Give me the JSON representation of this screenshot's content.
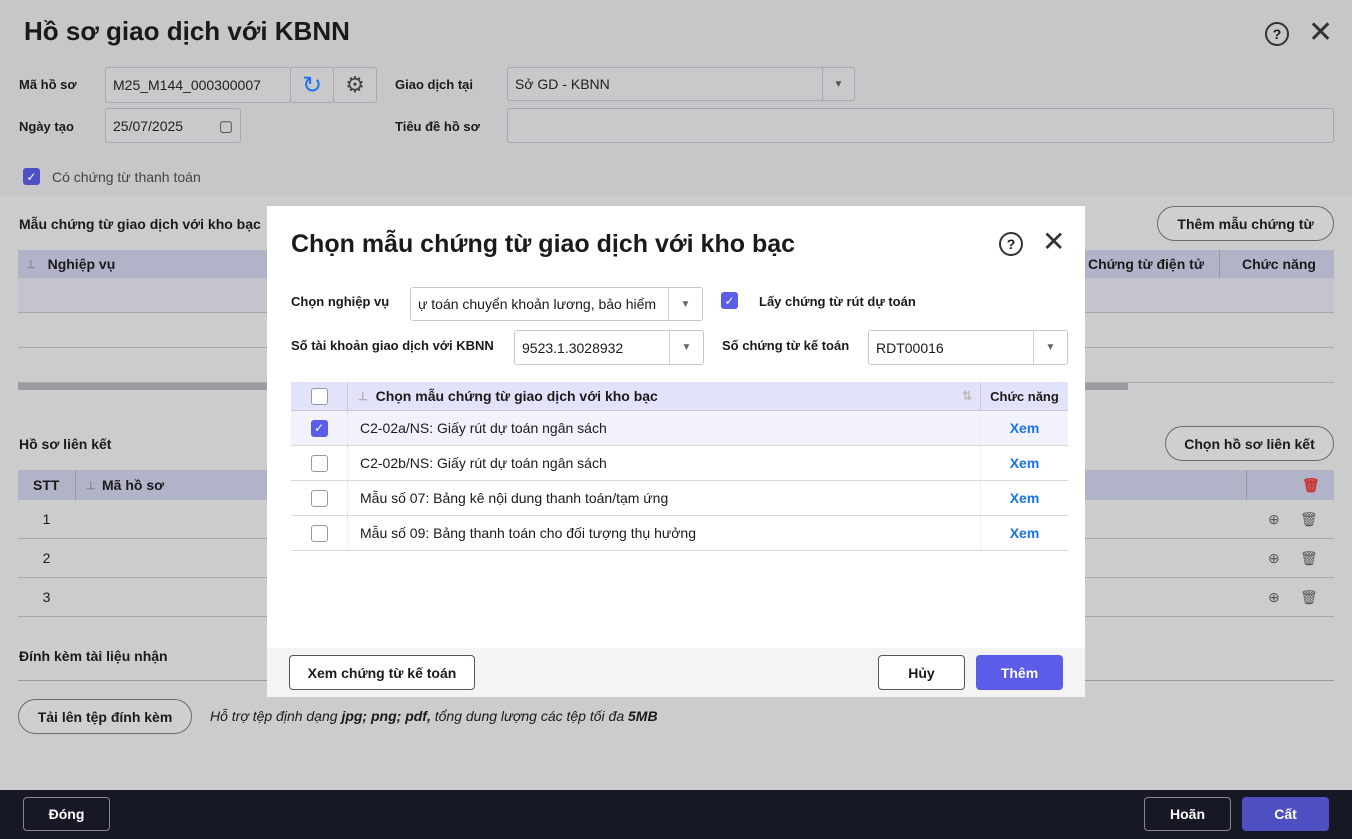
{
  "page": {
    "title": "Hồ sơ giao dịch với KBNN",
    "ma_ho_so_label": "Mã hồ sơ",
    "ma_ho_so_value": "M25_M144_000300007",
    "giao_dich_tai_label": "Giao dịch tại",
    "giao_dich_tai_value": "Sở GD - KBNN",
    "ngay_tao_label": "Ngày tạo",
    "ngay_tao_value": "25/07/2025",
    "tieu_de_label": "Tiêu đề hồ sơ",
    "tieu_de_value": "",
    "co_chung_tu_label": "Có chứng từ thanh toán",
    "co_chung_tu_checked": true
  },
  "mau_section": {
    "title": "Mẫu chứng từ giao dịch với kho bạc",
    "add_button": "Thêm mẫu chứng từ",
    "columns": [
      "Nghiệp vụ",
      "Chứng từ điện tử",
      "Chức năng"
    ]
  },
  "lien_ket": {
    "title": "Hồ sơ liên kết",
    "button": "Chọn hồ sơ liên kết",
    "columns": [
      "STT",
      "Mã hồ sơ"
    ],
    "rows": [
      "1",
      "2",
      "3"
    ]
  },
  "dinh_kem": {
    "title": "Đính kèm tài liệu nhận",
    "upload_button": "Tải lên tệp đính kèm",
    "hint_prefix": "Hỗ trợ tệp định dạng ",
    "hint_formats": "jpg; png; pdf,",
    "hint_mid": " tổng dung lượng các tệp tối đa ",
    "hint_size": "5MB"
  },
  "footer": {
    "close": "Đóng",
    "postpone": "Hoãn",
    "save": "Cất"
  },
  "modal": {
    "title": "Chọn mẫu chứng từ giao dịch với kho bạc",
    "nghiep_vu_label": "Chọn nghiệp vụ",
    "nghiep_vu_value": "ự toán chuyển khoản lương, bảo hiểm",
    "lay_chung_tu_label": "Lấy chứng từ rút dự toán",
    "lay_chung_tu_checked": true,
    "tai_khoan_label": "Số tài khoản giao dịch với KBNN",
    "tai_khoan_value": "9523.1.3028932",
    "so_chung_tu_label": "Số chứng từ kế toán",
    "so_chung_tu_value": "RDT00016",
    "col_name": "Chọn mẫu chứng từ giao dịch với kho bạc",
    "col_action": "Chức năng",
    "rows": [
      {
        "name": "C2-02a/NS: Giấy rút dự toán ngân sách",
        "action": "Xem",
        "checked": true
      },
      {
        "name": "C2-02b/NS: Giấy rút dự toán ngân sách",
        "action": "Xem",
        "checked": false
      },
      {
        "name": "Mẫu số 07: Bảng kê nội dung thanh toán/tạm ứng",
        "action": "Xem",
        "checked": false
      },
      {
        "name": "Mẫu số 09: Bảng thanh toán cho đối tượng thụ hưởng",
        "action": "Xem",
        "checked": false
      }
    ],
    "view_accounting": "Xem chứng từ kế toán",
    "cancel": "Hủy",
    "add": "Thêm"
  },
  "colors": {
    "accent": "#5b5ce8",
    "link": "#1a73e8",
    "footer_bg": "#161826"
  }
}
